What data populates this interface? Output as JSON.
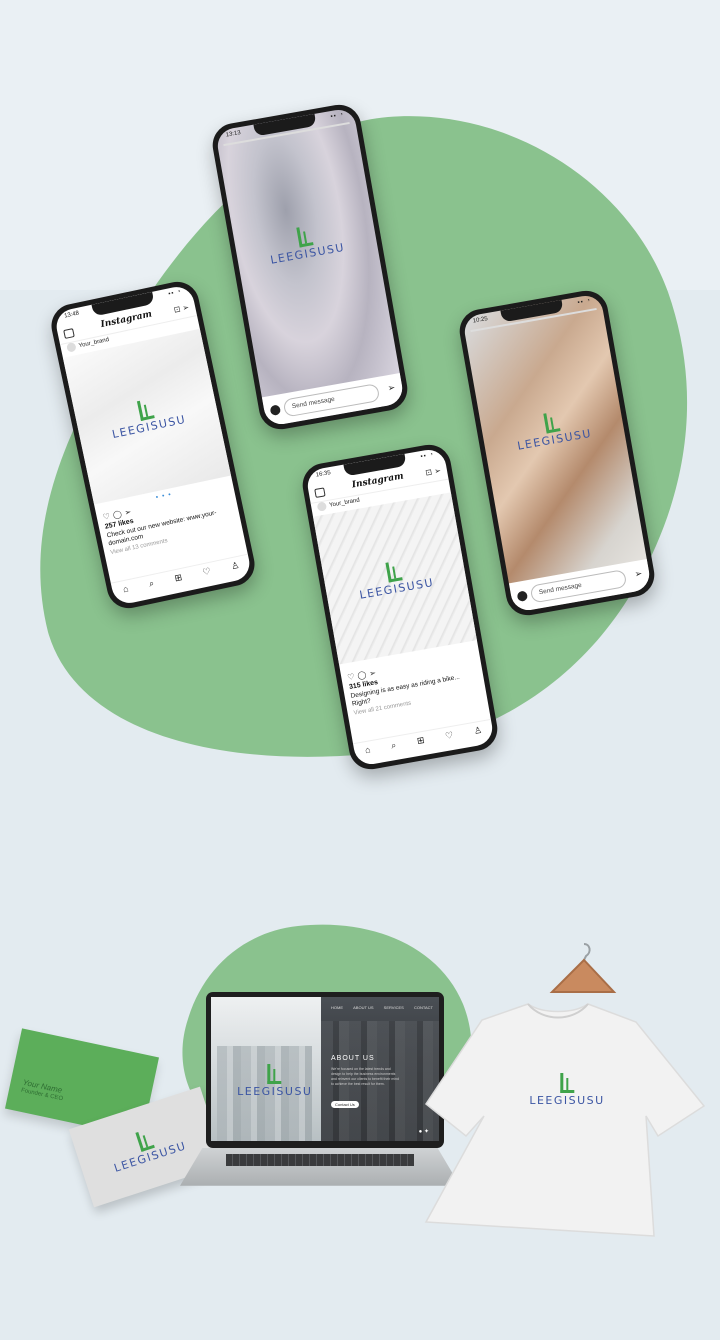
{
  "colors": {
    "accent_green": "#8ac28e",
    "logo_green": "#3fa34a",
    "logo_blue": "#3b55a3",
    "card_green": "#5cae5a"
  },
  "logo": {
    "text": "LEEGISUSU",
    "mark": "L"
  },
  "phones": {
    "left": {
      "time": "13:48",
      "app": "Instagram",
      "username": "Your_brand",
      "likes": "257 likes",
      "caption": "Check out our new website: www.your-domain.com",
      "comments": "View all 13 comments"
    },
    "top": {
      "time": "13:13",
      "message_placeholder": "Send message"
    },
    "right": {
      "time": "10:25",
      "message_placeholder": "Send message"
    },
    "bottom": {
      "time": "16:35",
      "app": "Instagram",
      "username": "Your_brand",
      "likes": "315 likes",
      "caption": "Designing is as easy as riding a bike... Right?",
      "comments": "View all 21 comments"
    }
  },
  "laptop": {
    "nav": [
      "HOME",
      "ABOUT US",
      "SERVICES",
      "CONTACT"
    ],
    "section_title": "ABOUT US",
    "body_text": "We're focused on the latest trends and design to help the business environments and reinvent our clients to benefit their mind to achieve the best result for them.",
    "button": "Contact Us"
  },
  "business_card": {
    "name": "Your Name",
    "role": "Founder & CEO"
  },
  "icons": [
    "home-icon",
    "search-icon",
    "add-icon",
    "heart-icon",
    "profile-icon",
    "camera-icon",
    "send-icon",
    "facebook-icon",
    "twitter-icon"
  ]
}
